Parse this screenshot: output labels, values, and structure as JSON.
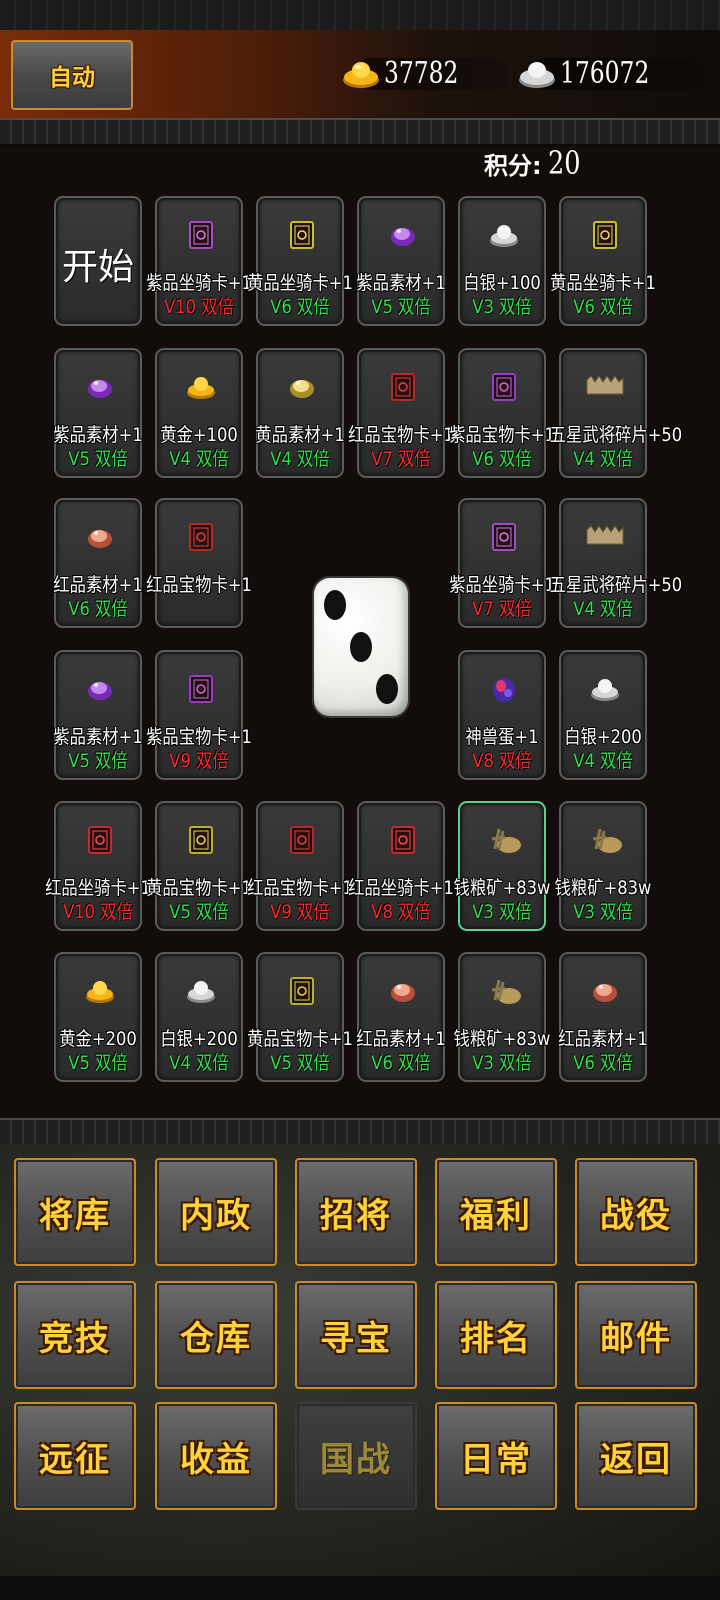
{
  "header": {
    "auto_label": "自动",
    "gold": "37782",
    "silver": "176072",
    "score_label": "积分:",
    "score_value": "20"
  },
  "board": {
    "start_label": "开始",
    "dice_value": 3,
    "cells": [
      {
        "name": "紫品坐骑卡+1",
        "bonus": "V10 双倍",
        "bonus_color": "red",
        "icon": "purple-mount-card-icon"
      },
      {
        "name": "黄品坐骑卡+1",
        "bonus": "V6 双倍",
        "bonus_color": "green",
        "icon": "yellow-mount-card-icon"
      },
      {
        "name": "紫品素材+1",
        "bonus": "V5 双倍",
        "bonus_color": "green",
        "icon": "purple-material-icon"
      },
      {
        "name": "白银+100",
        "bonus": "V3 双倍",
        "bonus_color": "green",
        "icon": "silver-ingot-icon"
      },
      {
        "name": "黄品坐骑卡+1",
        "bonus": "V6 双倍",
        "bonus_color": "green",
        "icon": "yellow-mount-card-icon"
      },
      {
        "name": "紫品素材+1",
        "bonus": "V5 双倍",
        "bonus_color": "green",
        "icon": "purple-material-icon"
      },
      {
        "name": "黄金+100",
        "bonus": "V4 双倍",
        "bonus_color": "green",
        "icon": "gold-ingot-icon"
      },
      {
        "name": "黄品素材+1",
        "bonus": "V4 双倍",
        "bonus_color": "green",
        "icon": "yellow-material-icon"
      },
      {
        "name": "红品宝物卡+1",
        "bonus": "V7 双倍",
        "bonus_color": "red",
        "icon": "red-treasure-card-icon"
      },
      {
        "name": "紫品宝物卡+1",
        "bonus": "V6 双倍",
        "bonus_color": "green",
        "icon": "purple-treasure-card-icon"
      },
      {
        "name": "五星武将碎片+50",
        "bonus": "V4 双倍",
        "bonus_color": "green",
        "icon": "general-fragment-icon"
      },
      {
        "name": "红品素材+1",
        "bonus": "V6 双倍",
        "bonus_color": "green",
        "icon": "red-material-icon"
      },
      {
        "name": "红品宝物卡+1",
        "bonus": "",
        "bonus_color": "green",
        "icon": "red-treasure-card-icon"
      },
      {
        "name": "紫品坐骑卡+1",
        "bonus": "V7 双倍",
        "bonus_color": "red",
        "icon": "purple-mount-card-icon"
      },
      {
        "name": "五星武将碎片+50",
        "bonus": "V4 双倍",
        "bonus_color": "green",
        "icon": "general-fragment-icon"
      },
      {
        "name": "紫品素材+1",
        "bonus": "V5 双倍",
        "bonus_color": "green",
        "icon": "purple-material-icon"
      },
      {
        "name": "紫品宝物卡+1",
        "bonus": "V9 双倍",
        "bonus_color": "red",
        "icon": "purple-treasure-card-icon"
      },
      {
        "name": "神兽蛋+1",
        "bonus": "V8 双倍",
        "bonus_color": "red",
        "icon": "beast-egg-icon"
      },
      {
        "name": "白银+200",
        "bonus": "V4 双倍",
        "bonus_color": "green",
        "icon": "silver-ingot-icon"
      },
      {
        "name": "红品坐骑卡+1",
        "bonus": "V10 双倍",
        "bonus_color": "red",
        "icon": "red-mount-card-icon"
      },
      {
        "name": "黄品宝物卡+1",
        "bonus": "V5 双倍",
        "bonus_color": "green",
        "icon": "yellow-treasure-card-icon"
      },
      {
        "name": "红品宝物卡+1",
        "bonus": "V9 双倍",
        "bonus_color": "red",
        "icon": "red-treasure-card-icon"
      },
      {
        "name": "红品坐骑卡+1",
        "bonus": "V8 双倍",
        "bonus_color": "red",
        "icon": "red-mount-card-icon"
      },
      {
        "name": "钱粮矿+83w",
        "bonus": "V3 双倍",
        "bonus_color": "green",
        "icon": "grain-ore-icon",
        "selected": true
      },
      {
        "name": "钱粮矿+83w",
        "bonus": "V3 双倍",
        "bonus_color": "green",
        "icon": "grain-ore-icon"
      },
      {
        "name": "黄金+200",
        "bonus": "V5 双倍",
        "bonus_color": "green",
        "icon": "gold-ingot-icon"
      },
      {
        "name": "白银+200",
        "bonus": "V4 双倍",
        "bonus_color": "green",
        "icon": "silver-ingot-icon"
      },
      {
        "name": "黄品宝物卡+1",
        "bonus": "V5 双倍",
        "bonus_color": "green",
        "icon": "yellow-treasure-card-icon"
      },
      {
        "name": "红品素材+1",
        "bonus": "V6 双倍",
        "bonus_color": "green",
        "icon": "red-material-icon"
      },
      {
        "name": "钱粮矿+83w",
        "bonus": "V3 双倍",
        "bonus_color": "green",
        "icon": "grain-ore-icon"
      },
      {
        "name": "红品素材+1",
        "bonus": "V6 双倍",
        "bonus_color": "green",
        "icon": "red-material-icon"
      }
    ]
  },
  "menu": {
    "buttons": [
      {
        "label": "将库"
      },
      {
        "label": "内政"
      },
      {
        "label": "招将"
      },
      {
        "label": "福利"
      },
      {
        "label": "战役"
      },
      {
        "label": "竞技"
      },
      {
        "label": "仓库"
      },
      {
        "label": "寻宝"
      },
      {
        "label": "排名"
      },
      {
        "label": "邮件"
      },
      {
        "label": "远征"
      },
      {
        "label": "收益"
      },
      {
        "label": "国战",
        "disabled": true
      },
      {
        "label": "日常"
      },
      {
        "label": "返回"
      }
    ]
  },
  "colors": {
    "green": "#33e04a",
    "red": "#ff2a2a",
    "gold_text": "#ffd23a",
    "button_border": "#c98a2a",
    "selected_border": "#57d38d"
  }
}
